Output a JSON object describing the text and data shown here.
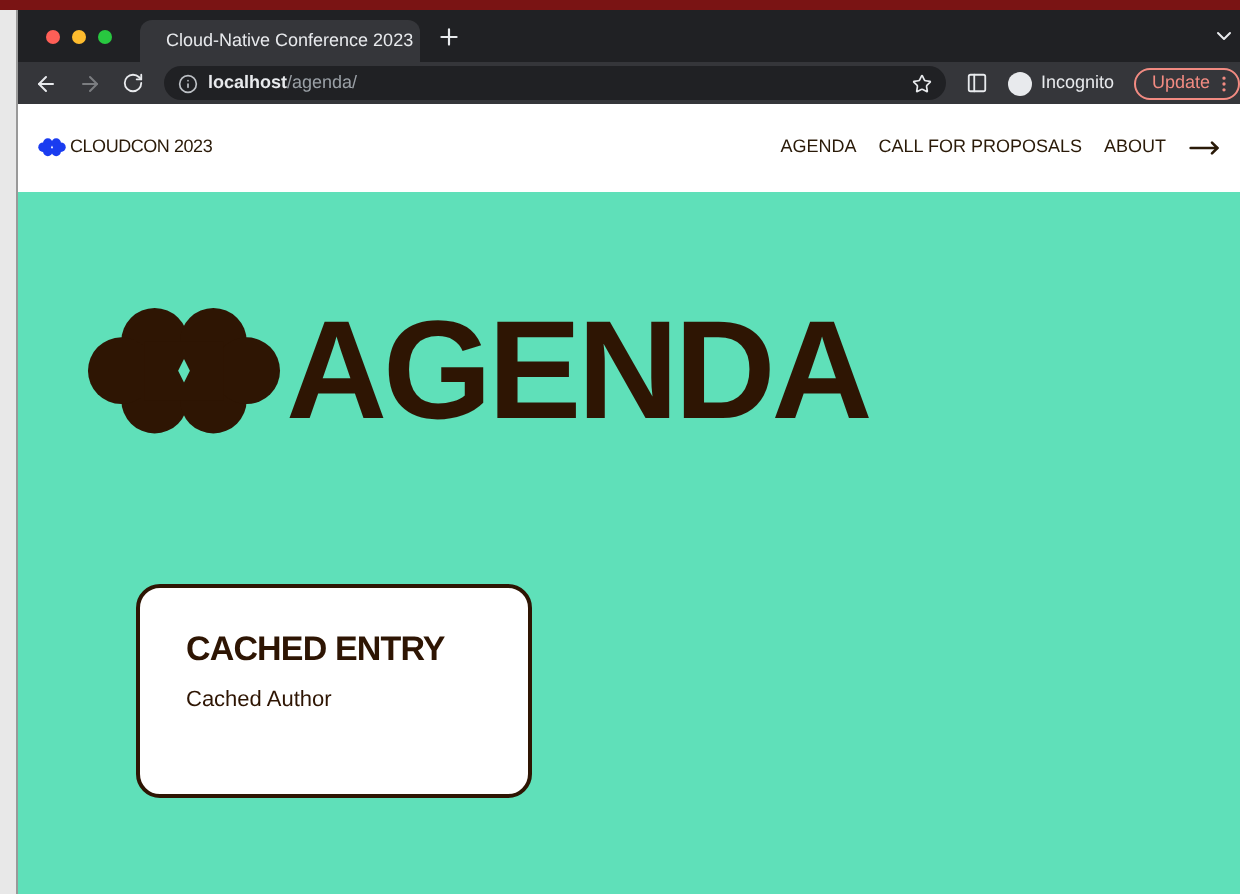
{
  "browser": {
    "tab_title": "Cloud-Native Conference 2023",
    "url_host": "localhost",
    "url_path": "/agenda/",
    "profile": "Incognito",
    "update_button": "Update"
  },
  "nav": {
    "brand": "CLOUDCON 2023",
    "links": [
      {
        "label": "AGENDA"
      },
      {
        "label": "CALL FOR PROPOSALS"
      },
      {
        "label": "ABOUT"
      }
    ]
  },
  "heading": "AGENDA",
  "entries": [
    {
      "title": "CACHED ENTRY",
      "author": "Cached Author"
    }
  ]
}
